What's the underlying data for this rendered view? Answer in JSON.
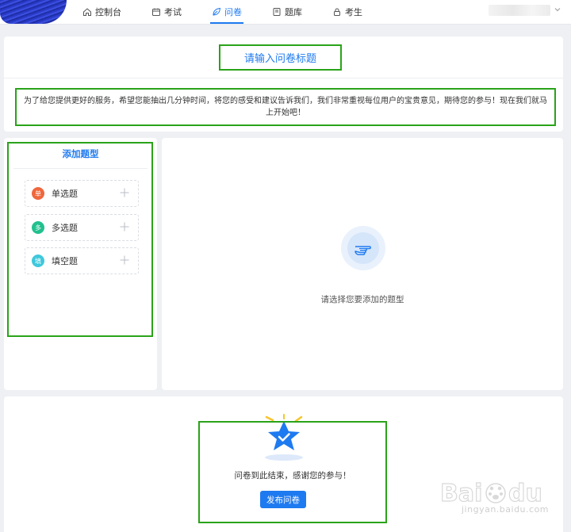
{
  "nav": {
    "items": [
      {
        "label": "控制台",
        "icon": "home-icon",
        "active": false
      },
      {
        "label": "考试",
        "icon": "calendar-icon",
        "active": false
      },
      {
        "label": "问卷",
        "icon": "leaf-icon",
        "active": true
      },
      {
        "label": "题库",
        "icon": "book-icon",
        "active": false
      },
      {
        "label": "考生",
        "icon": "lock-icon",
        "active": false
      }
    ]
  },
  "survey": {
    "title_placeholder": "请输入问卷标题",
    "description": "为了给您提供更好的服务，希望您能抽出几分钟时间，将您的感受和建议告诉我们，我们非常重视每位用户的宝贵意见，期待您的参与！现在我们就马上开始吧！"
  },
  "sidebar": {
    "title": "添加题型",
    "question_types": [
      {
        "badge": "单",
        "label": "单选题",
        "color": "#f0673d"
      },
      {
        "badge": "多",
        "label": "多选题",
        "color": "#22c08e"
      },
      {
        "badge": "填",
        "label": "填空题",
        "color": "#3fc8dc"
      }
    ]
  },
  "main": {
    "empty_hint": "请选择您要添加的题型"
  },
  "footer": {
    "end_text": "问卷到此结束，感谢您的参与！",
    "publish_label": "发布问卷"
  },
  "watermark": {
    "sub": "jingyan.baidu.com"
  },
  "colors": {
    "accent": "#1e7af0",
    "highlight": "#2aa319"
  }
}
